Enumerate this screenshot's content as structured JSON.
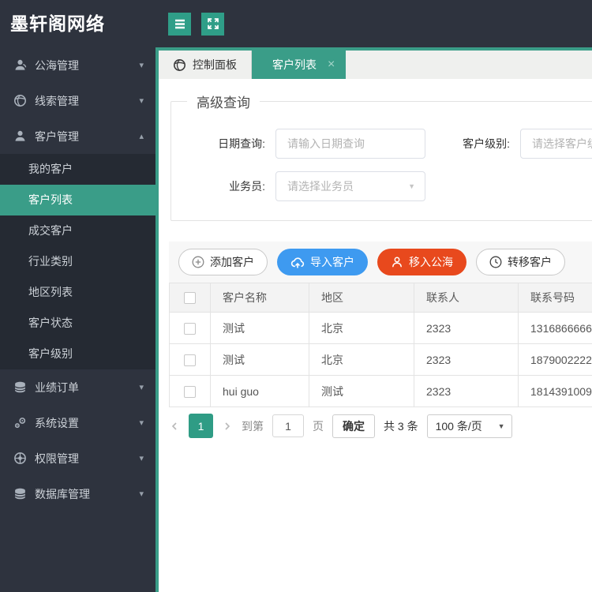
{
  "colors": {
    "accent": "#3a9d88",
    "primary_blue": "#3e9af0",
    "danger_red": "#e8491d",
    "sidebar_bg": "#2e333e",
    "submenu_bg": "#252a33"
  },
  "app": {
    "title": "墨轩阁网络"
  },
  "sidebar": {
    "items": [
      {
        "label": "公海管理",
        "icon": "user-group-icon",
        "chevron": "▾"
      },
      {
        "label": "线索管理",
        "icon": "globe-icon",
        "chevron": "▾"
      },
      {
        "label": "客户管理",
        "icon": "user-icon",
        "chevron": "▴",
        "expanded": true,
        "children": [
          {
            "label": "我的客户"
          },
          {
            "label": "客户列表",
            "active": true
          },
          {
            "label": "成交客户"
          },
          {
            "label": "行业类别"
          },
          {
            "label": "地区列表"
          },
          {
            "label": "客户状态"
          },
          {
            "label": "客户级别"
          }
        ]
      },
      {
        "label": "业绩订单",
        "icon": "database-icon",
        "chevron": "▾"
      },
      {
        "label": "系统设置",
        "icon": "gears-icon",
        "chevron": "▾"
      },
      {
        "label": "权限管理",
        "icon": "wheel-icon",
        "chevron": "▾"
      },
      {
        "label": "数据库管理",
        "icon": "database-icon",
        "chevron": "▾"
      }
    ]
  },
  "tabs": [
    {
      "label": "控制面板",
      "icon": "globe-icon",
      "active": false
    },
    {
      "label": "客户列表",
      "active": true,
      "close_icon": "close-icon"
    }
  ],
  "query": {
    "legend": "高级查询",
    "date": {
      "label": "日期查询:",
      "placeholder": "请输入日期查询"
    },
    "level": {
      "label": "客户级别:",
      "placeholder": "请选择客户级别"
    },
    "salesman": {
      "label": "业务员:",
      "placeholder": "请选择业务员"
    }
  },
  "toolbar": {
    "add": "添加客户",
    "import": "导入客户",
    "move": "移入公海",
    "transfer": "转移客户"
  },
  "table": {
    "columns": [
      "客户名称",
      "地区",
      "联系人",
      "联系号码"
    ],
    "rows": [
      {
        "name": "测试",
        "region": "北京",
        "contact": "2323",
        "phone": "1316866666"
      },
      {
        "name": "测试",
        "region": "北京",
        "contact": "2323",
        "phone": "1879002222"
      },
      {
        "name": "hui guo",
        "region": "测试",
        "contact": "2323",
        "phone": "1814391009"
      }
    ]
  },
  "pagination": {
    "current": "1",
    "goto_label": "到第",
    "goto_value": "1",
    "unit_label": "页",
    "confirm": "确定",
    "total": "共 3 条",
    "page_size": "100 条/页"
  }
}
